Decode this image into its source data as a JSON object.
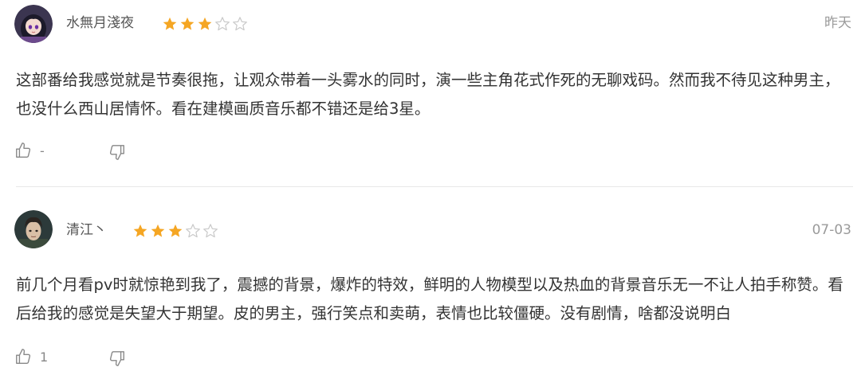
{
  "reviews": [
    {
      "username": "水無月淺夜",
      "rating": 3,
      "max_rating": 5,
      "date": "昨天",
      "content": "这部番给我感觉就是节奏很拖，让观众带着一头雾水的同时，演一些主角花式作死的无聊戏码。然而我不待见这种男主，也没什么西山居情怀。看在建模画质音乐都不错还是给3星。",
      "like_count": "-",
      "avatar_icon": "anime-girl-avatar"
    },
    {
      "username": "清江丶",
      "rating": 3,
      "max_rating": 5,
      "date": "07-03",
      "content": "前几个月看pv时就惊艳到我了，震撼的背景，爆炸的特效，鲜明的人物模型以及热血的背景音乐无一不让人拍手称赞。看后给我的感觉是失望大于期望。皮的男主，强行笑点和卖萌，表情也比较僵硬。没有剧情，啥都没说明白",
      "like_count": "1",
      "avatar_icon": "dark-hair-man-avatar"
    }
  ],
  "colors": {
    "star_filled": "#f5a623",
    "star_empty": "#c8c8c8",
    "text": "#333333",
    "username": "#555555",
    "date": "#9a9a9a",
    "icon": "#888888"
  },
  "icons": {
    "like": "thumbs-up-icon",
    "dislike": "thumbs-down-icon",
    "star": "star-icon"
  }
}
